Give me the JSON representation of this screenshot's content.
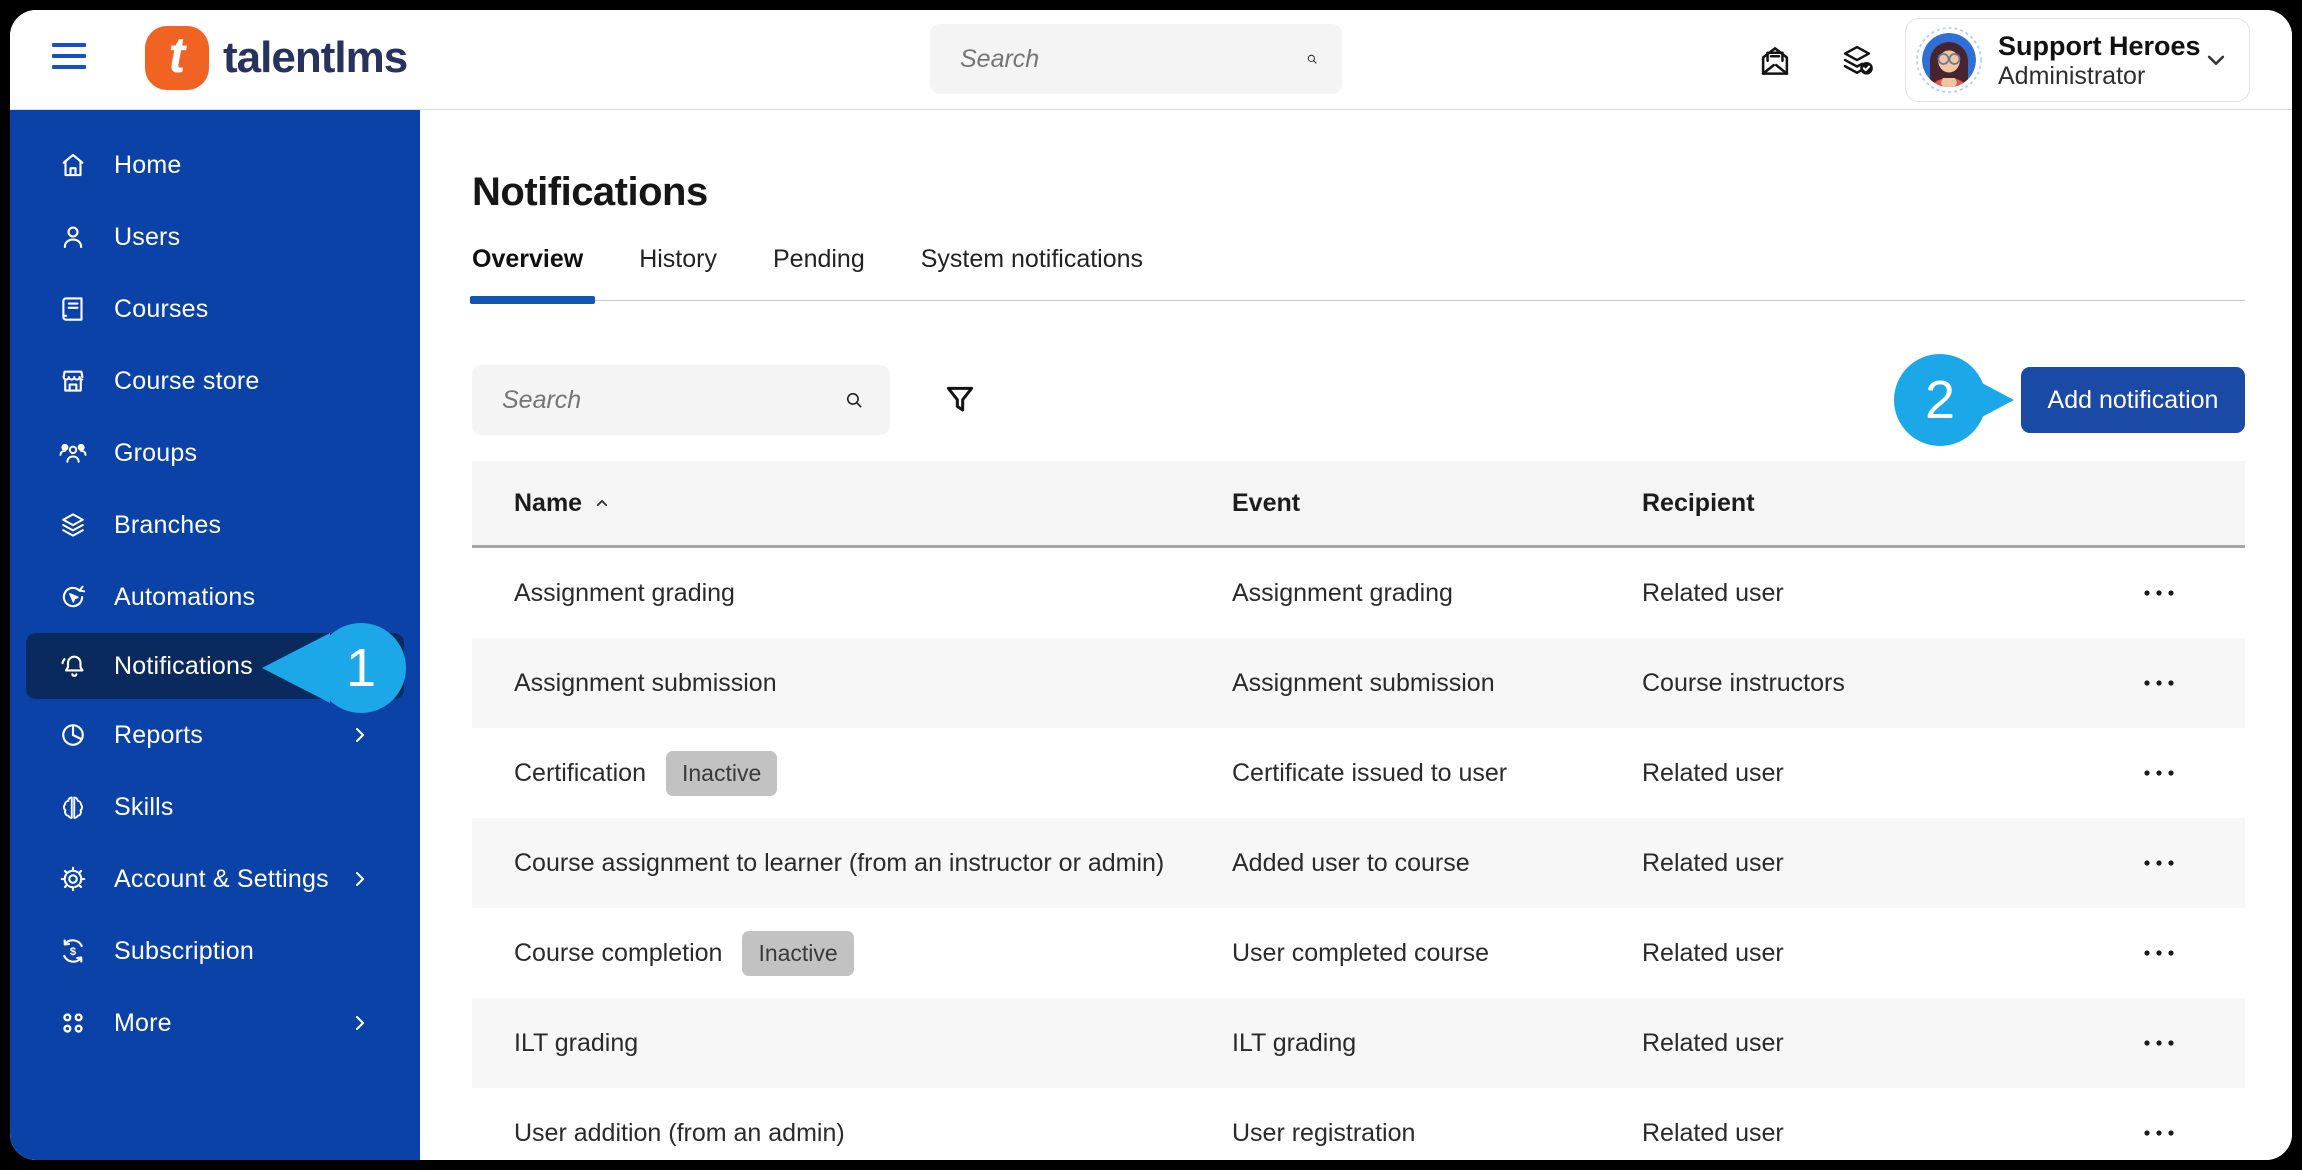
{
  "topbar": {
    "brand": "talentlms",
    "logo_letter": "t",
    "search_placeholder": "Search",
    "icons": [
      "message-icon",
      "courses-stack-icon"
    ],
    "user": {
      "name": "Support Heroes",
      "role": "Administrator"
    }
  },
  "sidebar": {
    "items": [
      {
        "label": "Home",
        "icon": "home-icon",
        "active": false,
        "has_chevron": false
      },
      {
        "label": "Users",
        "icon": "user-icon",
        "active": false,
        "has_chevron": false
      },
      {
        "label": "Courses",
        "icon": "book-icon",
        "active": false,
        "has_chevron": false
      },
      {
        "label": "Course store",
        "icon": "storefront-icon",
        "active": false,
        "has_chevron": false
      },
      {
        "label": "Groups",
        "icon": "groups-icon",
        "active": false,
        "has_chevron": false
      },
      {
        "label": "Branches",
        "icon": "layers-icon",
        "active": false,
        "has_chevron": false
      },
      {
        "label": "Automations",
        "icon": "automation-icon",
        "active": false,
        "has_chevron": false
      },
      {
        "label": "Notifications",
        "icon": "bell-icon",
        "active": true,
        "has_chevron": false
      },
      {
        "label": "Reports",
        "icon": "pie-chart-icon",
        "active": false,
        "has_chevron": true
      },
      {
        "label": "Skills",
        "icon": "brain-icon",
        "active": false,
        "has_chevron": false
      },
      {
        "label": "Account & Settings",
        "icon": "gear-icon",
        "active": false,
        "has_chevron": true
      },
      {
        "label": "Subscription",
        "icon": "renew-dollar-icon",
        "active": false,
        "has_chevron": false
      },
      {
        "label": "More",
        "icon": "grid-dots-icon",
        "active": false,
        "has_chevron": true
      }
    ]
  },
  "main": {
    "title": "Notifications",
    "tabs": [
      {
        "label": "Overview",
        "active": true
      },
      {
        "label": "History",
        "active": false
      },
      {
        "label": "Pending",
        "active": false
      },
      {
        "label": "System notifications",
        "active": false
      }
    ],
    "toolbar": {
      "search_placeholder": "Search",
      "filter_icon": "funnel-icon",
      "add_button_label": "Add notification"
    },
    "table": {
      "columns": [
        "Name",
        "Event",
        "Recipient"
      ],
      "sort": {
        "column": "Name",
        "direction": "asc"
      },
      "rows": [
        {
          "name": "Assignment grading",
          "badge": "",
          "event": "Assignment grading",
          "recipient": "Related user"
        },
        {
          "name": "Assignment submission",
          "badge": "",
          "event": "Assignment submission",
          "recipient": "Course instructors"
        },
        {
          "name": "Certification",
          "badge": "Inactive",
          "event": "Certificate issued to user",
          "recipient": "Related user"
        },
        {
          "name": "Course assignment to learner (from an instructor or admin)",
          "badge": "",
          "event": "Added user to course",
          "recipient": "Related user"
        },
        {
          "name": "Course completion",
          "badge": "Inactive",
          "event": "User completed course",
          "recipient": "Related user"
        },
        {
          "name": "ILT grading",
          "badge": "",
          "event": "ILT grading",
          "recipient": "Related user"
        },
        {
          "name": "User addition (from an admin)",
          "badge": "",
          "event": "User registration",
          "recipient": "Related user"
        }
      ]
    }
  },
  "callouts": {
    "step1": "1",
    "step2": "2"
  },
  "colors": {
    "sidebar_blue": "#0B42A7",
    "active_item_navy": "#0A2A5E",
    "callout_blue": "#1CA7E8",
    "button_blue": "#1A4AA5",
    "tab_underline_blue": "#1256B4",
    "brand_orange": "#F06322",
    "brand_navy": "#27325F",
    "badge_gray": "#C2C2C2",
    "row_alt_gray": "#F7F7F7",
    "header_gray": "#F5F5F5"
  }
}
